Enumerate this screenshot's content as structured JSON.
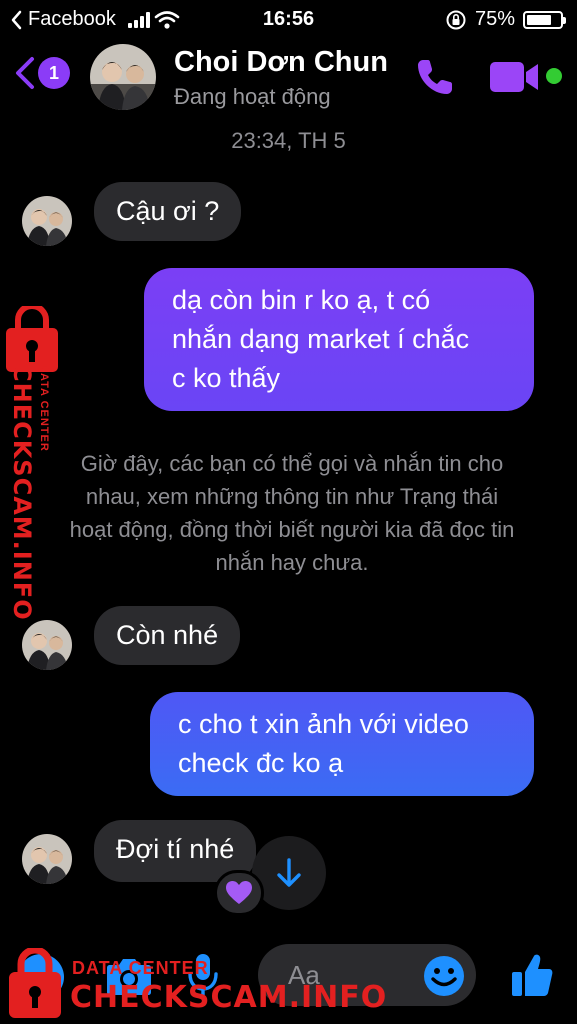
{
  "status_bar": {
    "carrier": "Facebook",
    "time": "16:56",
    "battery_percent": "75%",
    "battery_level": 0.75,
    "signal_bars": 4,
    "icons": [
      "back-to-app-icon",
      "signal-icon",
      "wifi-icon",
      "orientation-lock-icon",
      "battery-icon"
    ]
  },
  "header": {
    "back_badge": "1",
    "contact_name": "Choi Dơn Chun",
    "contact_status": "Đang hoạt động",
    "icons": [
      "back-chevron-icon",
      "phone-icon",
      "video-camera-icon"
    ],
    "online": true
  },
  "conversation": {
    "timestamp": "23:34, TH 5",
    "messages": [
      {
        "id": "m1",
        "direction": "incoming",
        "text": "Cậu ơi ?"
      },
      {
        "id": "m2",
        "direction": "outgoing",
        "lines": [
          "dạ còn bin r ko ạ, t có",
          "nhắn dạng market í chắc",
          "c ko thấy"
        ]
      },
      {
        "id": "m3",
        "direction": "incoming",
        "text": "Còn nhé"
      },
      {
        "id": "m4",
        "direction": "outgoing",
        "lines": [
          "c cho t xin ảnh với video",
          "check đc ko ạ"
        ]
      },
      {
        "id": "m5",
        "direction": "incoming",
        "text": "Đợi tí nhé",
        "reaction": "purple-heart"
      }
    ],
    "system_note_lines": [
      "Giờ đây, các bạn có thể gọi và nhắn tin cho",
      "nhau, xem những thông tin như Trạng thái",
      "hoạt động, đồng thời biết người kia đã đọc tin",
      "nhắn hay chưa."
    ]
  },
  "composer": {
    "placeholder": "Aa",
    "icons": [
      "more-actions-icon",
      "camera-icon",
      "microphone-icon",
      "emoji-icon",
      "like-thumb-icon"
    ]
  },
  "watermark": {
    "brand": "CHECKSCAM.INFO",
    "tagline": "DATA CENTER",
    "icon": "padlock-icon"
  },
  "colors": {
    "accent": "#8b3cf7",
    "bubble_out_top": "#7b3ff5",
    "bubble_out_bottom": "#4a5cf5",
    "bubble_in": "#2b2b2e",
    "watermark_red": "#e32020",
    "online_green": "#33cc33",
    "action_blue": "#1e90ff"
  }
}
